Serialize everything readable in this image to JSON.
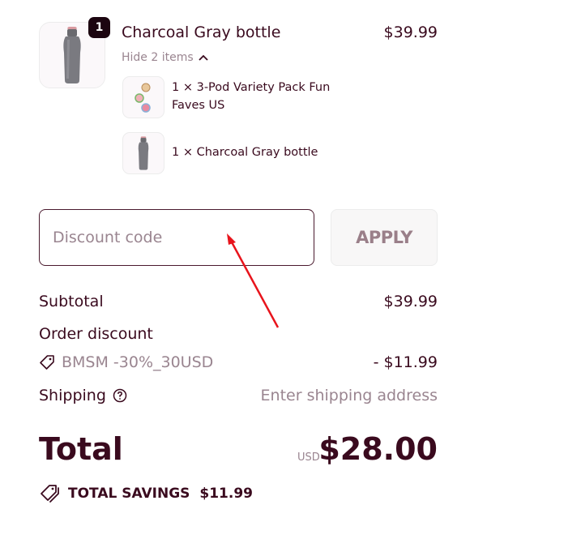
{
  "line_item": {
    "quantity_badge": "1",
    "name": "Charcoal Gray bottle",
    "price": "$39.99",
    "toggle_label": "Hide 2 items",
    "sub_items": [
      {
        "label": "1 × 3-Pod Variety Pack Fun Faves US"
      },
      {
        "label": "1 × Charcoal Gray bottle"
      }
    ]
  },
  "discount": {
    "placeholder": "Discount code",
    "apply_label": "APPLY"
  },
  "summary": {
    "subtotal_label": "Subtotal",
    "subtotal_value": "$39.99",
    "order_discount_label": "Order discount",
    "discount_code": "BMSM -30%_30USD",
    "discount_value": "- $11.99",
    "shipping_label": "Shipping",
    "shipping_value": "Enter shipping address",
    "total_label": "Total",
    "currency": "USD",
    "total_value": "$28.00",
    "savings_label": "TOTAL SAVINGS",
    "savings_value": "$11.99"
  },
  "icons": {
    "chevron": "chevron-up-icon",
    "tag": "tag-icon",
    "help": "question-circle-icon",
    "savings": "double-tag-icon"
  },
  "colors": {
    "text": "#3a0a1e",
    "muted": "#9a8590",
    "badge": "#1c0510",
    "annotation_arrow": "#e8141c"
  }
}
